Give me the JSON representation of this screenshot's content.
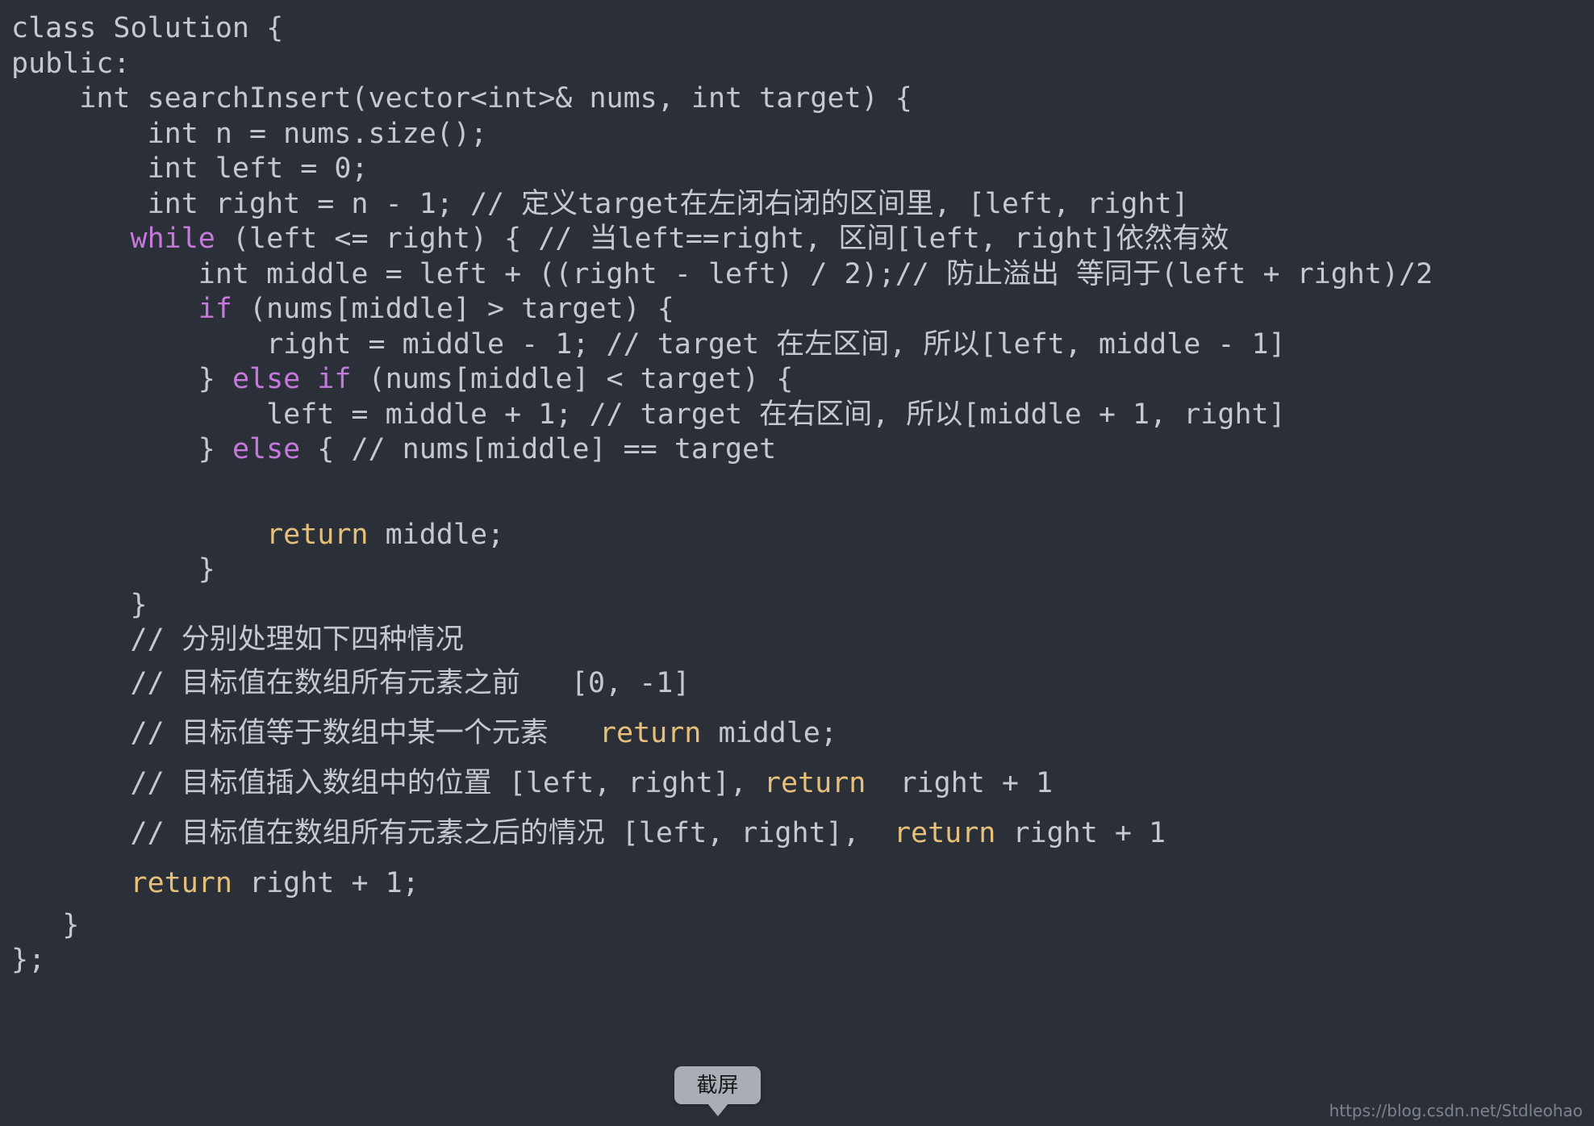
{
  "editor": {
    "background_color": "#2b3038",
    "default_text_color": "#c3c8d1",
    "keyword_color": "#c678dd",
    "return_color": "#e6c07b",
    "comment_color": "#aeb6c2",
    "language": "C++",
    "lines": [
      {
        "segments": [
          {
            "t": "class Solution {",
            "c": "plain"
          }
        ]
      },
      {
        "segments": [
          {
            "t": "public:",
            "c": "plain"
          }
        ]
      },
      {
        "segments": [
          {
            "t": "    int searchInsert(vector<int>& nums, int target) {",
            "c": "plain"
          }
        ]
      },
      {
        "segments": [
          {
            "t": "        int n = nums.size();",
            "c": "plain"
          }
        ]
      },
      {
        "segments": [
          {
            "t": "        int left = 0;",
            "c": "plain"
          }
        ]
      },
      {
        "segments": [
          {
            "t": "        int right = n - 1; // 定义target在左闭右闭的区间里, [left, right]",
            "c": "plain"
          }
        ]
      },
      {
        "segments": [
          {
            "t": "       ",
            "c": "plain"
          },
          {
            "t": "while",
            "c": "kw"
          },
          {
            "t": " (left <= right) { // 当left==right, 区间[left, right]依然有效",
            "c": "plain"
          }
        ]
      },
      {
        "segments": [
          {
            "t": "           int middle = left + ((right - left) / 2);// 防止溢出 等同于(left + right)/2",
            "c": "plain"
          }
        ]
      },
      {
        "segments": [
          {
            "t": "           ",
            "c": "plain"
          },
          {
            "t": "if",
            "c": "kw"
          },
          {
            "t": " (nums[middle] > target) {",
            "c": "plain"
          }
        ]
      },
      {
        "segments": [
          {
            "t": "               right = middle - 1; // target 在左区间, 所以[left, middle - 1]",
            "c": "plain"
          }
        ]
      },
      {
        "segments": [
          {
            "t": "           } ",
            "c": "plain"
          },
          {
            "t": "else if",
            "c": "kw"
          },
          {
            "t": " (nums[middle] < target) {",
            "c": "plain"
          }
        ]
      },
      {
        "segments": [
          {
            "t": "               left = middle + 1; // target 在右区间, 所以[middle + 1, right]",
            "c": "plain"
          }
        ]
      },
      {
        "segments": [
          {
            "t": "           } ",
            "c": "plain"
          },
          {
            "t": "else",
            "c": "kw"
          },
          {
            "t": " { // nums[middle] == target",
            "c": "plain"
          }
        ]
      },
      {
        "segments": [],
        "tall": true
      },
      {
        "segments": [
          {
            "t": "               ",
            "c": "plain"
          },
          {
            "t": "return",
            "c": "return"
          },
          {
            "t": " middle;",
            "c": "plain"
          }
        ]
      },
      {
        "segments": [
          {
            "t": "           }",
            "c": "plain"
          }
        ]
      },
      {
        "segments": [
          {
            "t": "       }",
            "c": "plain"
          }
        ]
      },
      {
        "segments": [
          {
            "t": "       // 分别处理如下四种情况",
            "c": "plain"
          }
        ]
      },
      {
        "segments": [
          {
            "t": "       // 目标值在数组所有元素之前   [0, -1]",
            "c": "plain"
          }
        ],
        "tall": true
      },
      {
        "segments": [
          {
            "t": "       // 目标值等于数组中某一个元素   ",
            "c": "plain"
          },
          {
            "t": "return",
            "c": "return"
          },
          {
            "t": " middle;",
            "c": "plain"
          }
        ],
        "tall": true
      },
      {
        "segments": [
          {
            "t": "       // 目标值插入数组中的位置 [left, right], ",
            "c": "plain"
          },
          {
            "t": "return",
            "c": "return"
          },
          {
            "t": "  right + 1",
            "c": "plain"
          }
        ],
        "tall": true
      },
      {
        "segments": [
          {
            "t": "       // 目标值在数组所有元素之后的情况 [left, right],  ",
            "c": "plain"
          },
          {
            "t": "return",
            "c": "return"
          },
          {
            "t": " right + 1",
            "c": "plain"
          }
        ],
        "tall": true
      },
      {
        "segments": [
          {
            "t": "       ",
            "c": "plain"
          },
          {
            "t": "return",
            "c": "return"
          },
          {
            "t": " right + 1;",
            "c": "plain"
          }
        ],
        "tall": true
      },
      {
        "segments": [
          {
            "t": "   }",
            "c": "plain"
          }
        ]
      },
      {
        "segments": [
          {
            "t": "};",
            "c": "plain"
          }
        ]
      }
    ]
  },
  "screenshot_tooltip": {
    "label": "截屏",
    "background_color": "#a9adb4"
  },
  "watermark": {
    "text": "https://blog.csdn.net/Stdleohao",
    "color": "#7d838d"
  }
}
